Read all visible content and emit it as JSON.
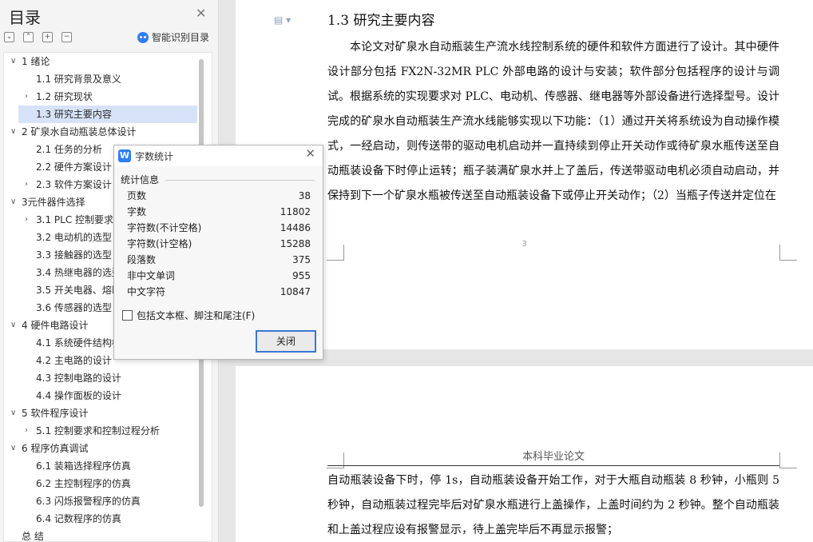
{
  "sidebar": {
    "title": "目录",
    "smart_label": "智能识别目录",
    "tools": [
      "⌄",
      "⌃",
      "+",
      "−"
    ],
    "items": [
      {
        "label": "1  绪论",
        "level": 1,
        "caret": "∨"
      },
      {
        "label": "1.1 研究背景及意义",
        "level": 2,
        "caret": ""
      },
      {
        "label": "1.2 研究现状",
        "level": 2,
        "caret": "›"
      },
      {
        "label": "1.3 研究主要内容",
        "level": 2,
        "caret": "",
        "active": true
      },
      {
        "label": "2  矿泉水自动瓶装总体设计",
        "level": 1,
        "caret": "∨"
      },
      {
        "label": "2.1 任务的分析",
        "level": 2,
        "caret": ""
      },
      {
        "label": "2.2 硬件方案设计",
        "level": 2,
        "caret": ""
      },
      {
        "label": "2.3 软件方案设计",
        "level": 2,
        "caret": "›"
      },
      {
        "label": "3元件器件选择",
        "level": 1,
        "caret": "∨"
      },
      {
        "label": "3.1 PLC 控制要求和",
        "level": 2,
        "caret": "›"
      },
      {
        "label": "3.2 电动机的选型",
        "level": 2,
        "caret": ""
      },
      {
        "label": "3.3 接触器的选型",
        "level": 2,
        "caret": ""
      },
      {
        "label": "3.4 热继电器的选型",
        "level": 2,
        "caret": ""
      },
      {
        "label": "3.5 开关电器、熔断",
        "level": 2,
        "caret": ""
      },
      {
        "label": "3.6 传感器的选型",
        "level": 2,
        "caret": ""
      },
      {
        "label": "4  硬件电路设计",
        "level": 1,
        "caret": "∨"
      },
      {
        "label": "4.1 系统硬件结构框",
        "level": 2,
        "caret": ""
      },
      {
        "label": "4.2 主电路的设计",
        "level": 2,
        "caret": ""
      },
      {
        "label": "4.3 控制电路的设计",
        "level": 2,
        "caret": ""
      },
      {
        "label": "4.4 操作面板的设计",
        "level": 2,
        "caret": ""
      },
      {
        "label": "5  软件程序设计",
        "level": 1,
        "caret": "∨"
      },
      {
        "label": "5.1 控制要求和控制过程分析",
        "level": 2,
        "caret": "›"
      },
      {
        "label": "6  程序仿真调试",
        "level": 1,
        "caret": "∨"
      },
      {
        "label": "6.1 装箱选择程序仿真",
        "level": 2,
        "caret": ""
      },
      {
        "label": "6.2 主控制程序的仿真",
        "level": 2,
        "caret": ""
      },
      {
        "label": "6.3 闪烁报警程序的仿真",
        "level": 2,
        "caret": ""
      },
      {
        "label": "6.4 记数程序的仿真",
        "level": 2,
        "caret": ""
      },
      {
        "label": "总  结",
        "level": 1,
        "caret": ""
      }
    ]
  },
  "document": {
    "section_title": "1.3 研究主要内容",
    "paragraph1": "本论文对矿泉水自动瓶装生产流水线控制系统的硬件和软件方面进行了设计。其中硬件设计部分包括 FX2N-32MR PLC 外部电路的设计与安装；软件部分包括程序的设计与调试。根据系统的实现要求对 PLC、电动机、传感器、继电器等外部设备进行选择型号。设计完成的矿泉水自动瓶装生产流水线能够实现以下功能：（1）通过开关将系统设为自动操作模式，一经启动，则传送带的驱动电机启动并一直持续到停止开关动作或待矿泉水瓶传送至自动瓶装设备下时停止运转；瓶子装满矿泉水并上了盖后，传送带驱动电机必须自动启动，并保持到下一个矿泉水瓶被传送至自动瓶装设备下或停止开关动作；（2）当瓶子传送并定位在",
    "page_number": "3",
    "page2_header": "本科毕业论文",
    "paragraph2": "自动瓶装设备下时，停 1s，自动瓶装设备开始工作，对于大瓶自动瓶装 8 秒钟，小瓶则 5 秒钟，自动瓶装过程完毕后对矿泉水瓶进行上盖操作，上盖时间约为 2 秒钟。整个自动瓶装和上盖过程应设有报警显示，待上盖完毕后不再显示报警；"
  },
  "dialog": {
    "title": "字数统计",
    "icon_letter": "W",
    "section": "统计信息",
    "stats": [
      {
        "label": "页数",
        "value": "38"
      },
      {
        "label": "字数",
        "value": "11802"
      },
      {
        "label": "字符数(不计空格)",
        "value": "14486"
      },
      {
        "label": "字符数(计空格)",
        "value": "15288"
      },
      {
        "label": "段落数",
        "value": "375"
      },
      {
        "label": "非中文单词",
        "value": "955"
      },
      {
        "label": "中文字符",
        "value": "10847"
      }
    ],
    "checkbox_label": "包括文本框、脚注和尾注(F)",
    "checkbox_checked": false,
    "close_label": "关闭"
  }
}
